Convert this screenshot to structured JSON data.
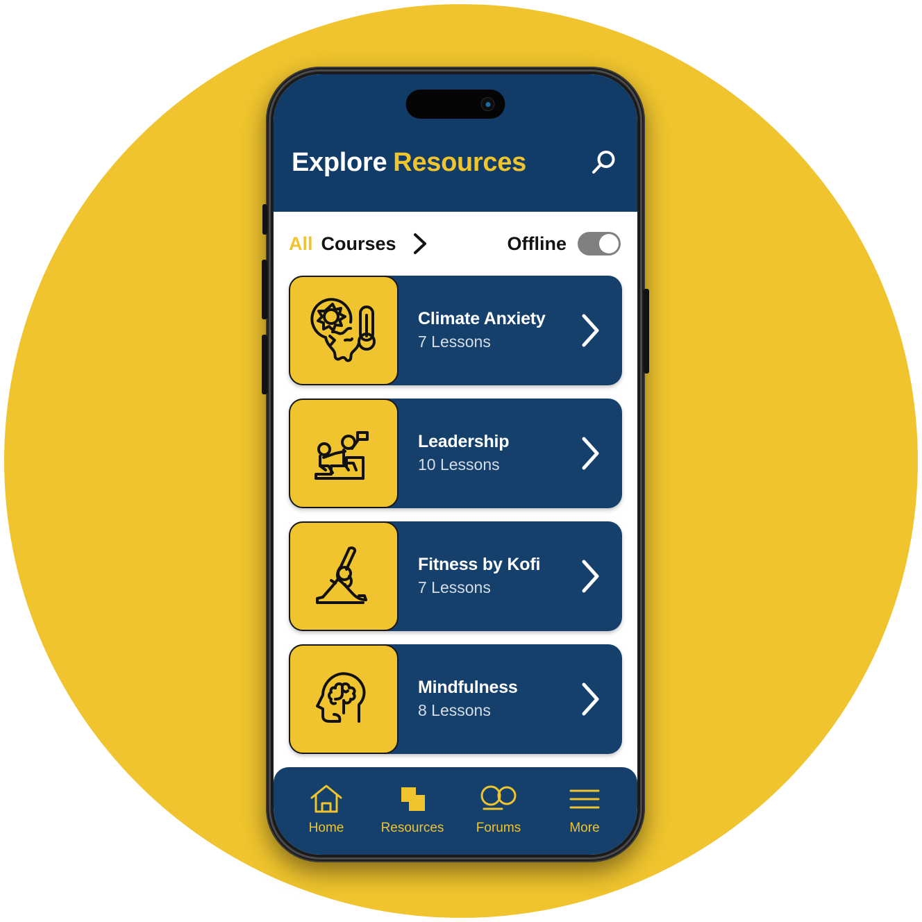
{
  "theme": {
    "backdrop_yellow": "#EFC42E",
    "header_navy": "#123C68",
    "card_navy": "#14406B",
    "accent_yellow": "#EFC42E",
    "toggle_track_gray": "#808080"
  },
  "device": {
    "dynamic_island": "dynamic-island",
    "camera": "front-camera"
  },
  "header": {
    "title_primary": "Explore",
    "title_accent": "Resources",
    "search_icon": "search-icon"
  },
  "filter_bar": {
    "scope_label": "All",
    "category_label": "Courses",
    "chevron_icon": "chevron-right-icon",
    "offline_label": "Offline",
    "offline_toggle_on": true
  },
  "courses": [
    {
      "title": "Climate Anxiety",
      "lessons": "7 Lessons",
      "icon": "melting-globe-thermometer-icon",
      "chevron_icon": "chevron-right-icon"
    },
    {
      "title": "Leadership",
      "lessons": "10 Lessons",
      "icon": "people-stairs-flag-icon",
      "chevron_icon": "chevron-right-icon"
    },
    {
      "title": "Fitness by Kofi",
      "lessons": "7 Lessons",
      "icon": "yoga-lunge-pose-icon",
      "chevron_icon": "chevron-right-icon"
    },
    {
      "title": "Mindfulness",
      "lessons": "8 Lessons",
      "icon": "head-brain-icon",
      "chevron_icon": "chevron-right-icon"
    }
  ],
  "bottom_nav": [
    {
      "label": "Home",
      "icon": "home-icon"
    },
    {
      "label": "Resources",
      "icon": "squares-icon"
    },
    {
      "label": "Forums",
      "icon": "two-circles-icon"
    },
    {
      "label": "More",
      "icon": "hamburger-menu-icon"
    }
  ]
}
